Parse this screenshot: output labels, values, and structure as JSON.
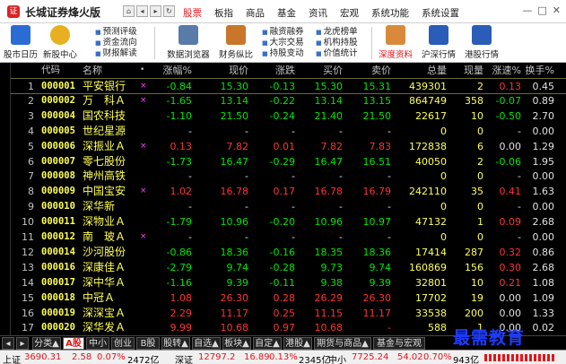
{
  "app": {
    "title": "长城证券烽火版"
  },
  "menu": [
    "股票",
    "板指",
    "商品",
    "基金",
    "资讯",
    "宏观",
    "系统功能",
    "系统设置"
  ],
  "toolbar": {
    "big": [
      "股市日历",
      "新股中心",
      "数据浏览器",
      "财务纵比",
      "深度资料",
      "沪深行情",
      "港股行情"
    ],
    "stack1": [
      "预测评级",
      "资金流向",
      "财报解读"
    ],
    "stack2": [
      "融资融券",
      "大宗交易",
      "持股变动"
    ],
    "stack3": [
      "龙虎榜单",
      "机构持股",
      "价值统计"
    ]
  },
  "headers": [
    "代码",
    "名称",
    "•",
    "涨幅%",
    "现价",
    "涨跌",
    "买价",
    "卖价",
    "总量",
    "现量",
    "涨速%",
    "换手%"
  ],
  "rows": [
    {
      "idx": "1",
      "code": "000001",
      "name": "平安银行",
      "mark": "×",
      "pct": "-0.84",
      "price": "15.30",
      "chg": "-0.13",
      "bid": "15.30",
      "ask": "15.31",
      "vol": "439301",
      "cur": "2",
      "spd": "0.13",
      "turn": "0.45",
      "c": "dn",
      "cc": "up"
    },
    {
      "idx": "2",
      "code": "000002",
      "name": "万　科Ａ",
      "mark": "×",
      "pct": "-1.65",
      "price": "13.14",
      "chg": "-0.22",
      "bid": "13.14",
      "ask": "13.15",
      "vol": "864749",
      "cur": "358",
      "spd": "-0.07",
      "turn": "0.89",
      "c": "dn",
      "cc": "dn"
    },
    {
      "idx": "3",
      "code": "000004",
      "name": "国农科技",
      "mark": "",
      "pct": "-1.10",
      "price": "21.50",
      "chg": "-0.24",
      "bid": "21.40",
      "ask": "21.50",
      "vol": "22617",
      "cur": "10",
      "spd": "-0.50",
      "turn": "2.70",
      "c": "dn",
      "cc": "dn"
    },
    {
      "idx": "4",
      "code": "000005",
      "name": "世纪星源",
      "mark": "",
      "pct": "-",
      "price": "-",
      "chg": "-",
      "bid": "-",
      "ask": "-",
      "vol": "0",
      "cur": "0",
      "spd": "-",
      "turn": "0.00",
      "c": "eq",
      "cc": "eq"
    },
    {
      "idx": "5",
      "code": "000006",
      "name": "深振业Ａ",
      "mark": "×",
      "pct": "0.13",
      "price": "7.82",
      "chg": "0.01",
      "bid": "7.82",
      "ask": "7.83",
      "vol": "172838",
      "cur": "6",
      "spd": "0.00",
      "turn": "1.29",
      "c": "up",
      "cc": "eq"
    },
    {
      "idx": "6",
      "code": "000007",
      "name": "零七股份",
      "mark": "",
      "pct": "-1.73",
      "price": "16.47",
      "chg": "-0.29",
      "bid": "16.47",
      "ask": "16.51",
      "vol": "40050",
      "cur": "2",
      "spd": "-0.06",
      "turn": "1.95",
      "c": "dn",
      "cc": "dn"
    },
    {
      "idx": "7",
      "code": "000008",
      "name": "神州高铁",
      "mark": "",
      "pct": "-",
      "price": "-",
      "chg": "-",
      "bid": "-",
      "ask": "-",
      "vol": "0",
      "cur": "0",
      "spd": "-",
      "turn": "0.00",
      "c": "eq",
      "cc": "eq"
    },
    {
      "idx": "8",
      "code": "000009",
      "name": "中国宝安",
      "mark": "×",
      "pct": "1.02",
      "price": "16.78",
      "chg": "0.17",
      "bid": "16.78",
      "ask": "16.79",
      "vol": "242110",
      "cur": "35",
      "spd": "0.41",
      "turn": "1.63",
      "c": "up",
      "cc": "up"
    },
    {
      "idx": "9",
      "code": "000010",
      "name": "深华新",
      "mark": "",
      "pct": "-",
      "price": "-",
      "chg": "-",
      "bid": "-",
      "ask": "-",
      "vol": "0",
      "cur": "0",
      "spd": "-",
      "turn": "0.00",
      "c": "eq",
      "cc": "eq"
    },
    {
      "idx": "10",
      "code": "000011",
      "name": "深物业Ａ",
      "mark": "",
      "pct": "-1.79",
      "price": "10.96",
      "chg": "-0.20",
      "bid": "10.96",
      "ask": "10.97",
      "vol": "47132",
      "cur": "1",
      "spd": "0.09",
      "turn": "2.68",
      "c": "dn",
      "cc": "up"
    },
    {
      "idx": "11",
      "code": "000012",
      "name": "南　玻Ａ",
      "mark": "×",
      "pct": "-",
      "price": "-",
      "chg": "-",
      "bid": "-",
      "ask": "-",
      "vol": "0",
      "cur": "0",
      "spd": "-",
      "turn": "0.00",
      "c": "eq",
      "cc": "eq"
    },
    {
      "idx": "12",
      "code": "000014",
      "name": "沙河股份",
      "mark": "",
      "pct": "-0.86",
      "price": "18.36",
      "chg": "-0.16",
      "bid": "18.35",
      "ask": "18.36",
      "vol": "17414",
      "cur": "287",
      "spd": "0.32",
      "turn": "0.86",
      "c": "dn",
      "cc": "up"
    },
    {
      "idx": "13",
      "code": "000016",
      "name": "深康佳Ａ",
      "mark": "",
      "pct": "-2.79",
      "price": "9.74",
      "chg": "-0.28",
      "bid": "9.73",
      "ask": "9.74",
      "vol": "160869",
      "cur": "156",
      "spd": "0.30",
      "turn": "2.68",
      "c": "dn",
      "cc": "up"
    },
    {
      "idx": "14",
      "code": "000017",
      "name": "深中华Ａ",
      "mark": "",
      "pct": "-1.16",
      "price": "9.39",
      "chg": "-0.11",
      "bid": "9.38",
      "ask": "9.39",
      "vol": "32801",
      "cur": "10",
      "spd": "0.21",
      "turn": "1.08",
      "c": "dn",
      "cc": "up"
    },
    {
      "idx": "15",
      "code": "000018",
      "name": "中冠Ａ",
      "mark": "",
      "pct": "1.08",
      "price": "26.30",
      "chg": "0.28",
      "bid": "26.29",
      "ask": "26.30",
      "vol": "17702",
      "cur": "19",
      "spd": "0.00",
      "turn": "1.09",
      "c": "up",
      "cc": "eq"
    },
    {
      "idx": "16",
      "code": "000019",
      "name": "深深宝Ａ",
      "mark": "",
      "pct": "2.29",
      "price": "11.17",
      "chg": "0.25",
      "bid": "11.15",
      "ask": "11.17",
      "vol": "33538",
      "cur": "200",
      "spd": "0.00",
      "turn": "1.33",
      "c": "up",
      "cc": "eq"
    },
    {
      "idx": "17",
      "code": "000020",
      "name": "深华发Ａ",
      "mark": "",
      "pct": "9.99",
      "price": "10.68",
      "chg": "0.97",
      "bid": "10.68",
      "ask": "-",
      "vol": "588",
      "cur": "1",
      "spd": "0.00",
      "turn": "0.02",
      "c": "up",
      "cc": "eq"
    }
  ],
  "tabs": [
    "分类▲",
    "A股",
    "中小",
    "创业",
    "B股",
    "股转▲",
    "自选▲",
    "板块▲",
    "自定▲",
    "港股▲",
    "期货与商品▲",
    "基金与宏观"
  ],
  "status": {
    "sh_label": "上证",
    "sh_val": "3690.31",
    "sh_chg": "2.58",
    "sh_pct": "0.07%",
    "sh_amt": "2472亿",
    "sz_label": "深证",
    "sz_val": "12797.2",
    "sz_chg": "16.89",
    "sz_pct": "0.13%",
    "sz_amt": "2345亿",
    "zx_label": "中小",
    "zx_val": "7725.24",
    "zx_chg": "54.02",
    "zx_pct": "0.70%",
    "zx_amt": "943亿"
  },
  "watermark": "最需教育",
  "colors": {
    "up": "#ff3232",
    "down": "#00e600",
    "code": "#ffff54",
    "accent": "#e4141a"
  }
}
